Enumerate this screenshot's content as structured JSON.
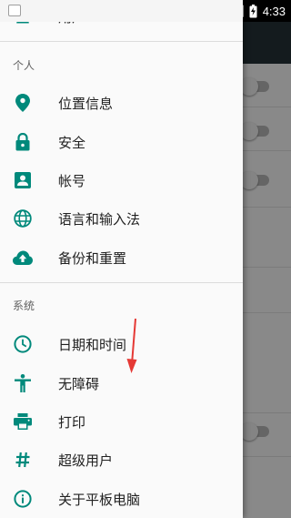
{
  "status_bar": {
    "time": "4:33",
    "icons": [
      "wifi-icon",
      "battery-charging-icon",
      "signal-off-icon"
    ]
  },
  "drawer": {
    "top_item": {
      "label": "用户",
      "icon": "person-icon"
    },
    "sections": [
      {
        "header": "个人",
        "items": [
          {
            "label": "位置信息",
            "icon": "location-pin-icon"
          },
          {
            "label": "安全",
            "icon": "lock-icon"
          },
          {
            "label": "帐号",
            "icon": "account-box-icon"
          },
          {
            "label": "语言和输入法",
            "icon": "globe-icon"
          },
          {
            "label": "备份和重置",
            "icon": "cloud-upload-icon"
          }
        ]
      },
      {
        "header": "系统",
        "items": [
          {
            "label": "日期和时间",
            "icon": "clock-icon"
          },
          {
            "label": "无障碍",
            "icon": "accessibility-icon"
          },
          {
            "label": "打印",
            "icon": "printer-icon"
          },
          {
            "label": "超级用户",
            "icon": "hash-icon"
          },
          {
            "label": "关于平板电脑",
            "icon": "info-icon"
          }
        ]
      }
    ]
  },
  "colors": {
    "icon_teal": "#00897b",
    "annotation_red": "#e53935",
    "background_appbar": "#263238"
  }
}
